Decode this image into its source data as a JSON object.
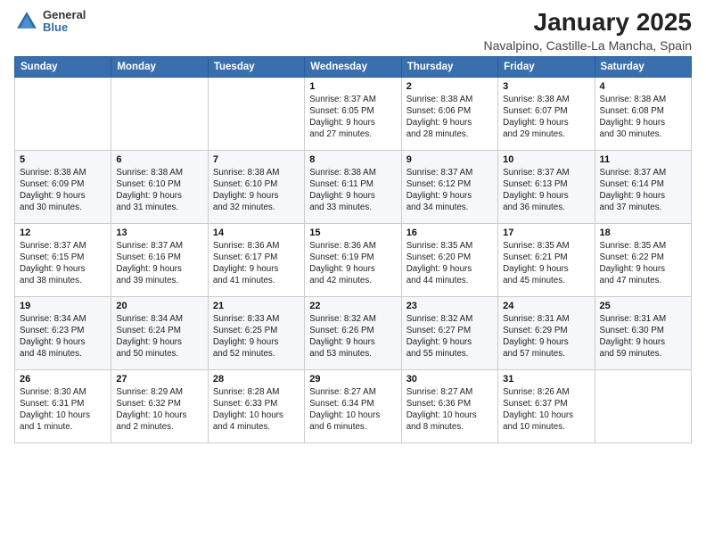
{
  "logo": {
    "general": "General",
    "blue": "Blue"
  },
  "header": {
    "title": "January 2025",
    "subtitle": "Navalpino, Castille-La Mancha, Spain"
  },
  "weekdays": [
    "Sunday",
    "Monday",
    "Tuesday",
    "Wednesday",
    "Thursday",
    "Friday",
    "Saturday"
  ],
  "weeks": [
    [
      {
        "day": "",
        "info": ""
      },
      {
        "day": "",
        "info": ""
      },
      {
        "day": "",
        "info": ""
      },
      {
        "day": "1",
        "info": "Sunrise: 8:37 AM\nSunset: 6:05 PM\nDaylight: 9 hours\nand 27 minutes."
      },
      {
        "day": "2",
        "info": "Sunrise: 8:38 AM\nSunset: 6:06 PM\nDaylight: 9 hours\nand 28 minutes."
      },
      {
        "day": "3",
        "info": "Sunrise: 8:38 AM\nSunset: 6:07 PM\nDaylight: 9 hours\nand 29 minutes."
      },
      {
        "day": "4",
        "info": "Sunrise: 8:38 AM\nSunset: 6:08 PM\nDaylight: 9 hours\nand 30 minutes."
      }
    ],
    [
      {
        "day": "5",
        "info": "Sunrise: 8:38 AM\nSunset: 6:09 PM\nDaylight: 9 hours\nand 30 minutes."
      },
      {
        "day": "6",
        "info": "Sunrise: 8:38 AM\nSunset: 6:10 PM\nDaylight: 9 hours\nand 31 minutes."
      },
      {
        "day": "7",
        "info": "Sunrise: 8:38 AM\nSunset: 6:10 PM\nDaylight: 9 hours\nand 32 minutes."
      },
      {
        "day": "8",
        "info": "Sunrise: 8:38 AM\nSunset: 6:11 PM\nDaylight: 9 hours\nand 33 minutes."
      },
      {
        "day": "9",
        "info": "Sunrise: 8:37 AM\nSunset: 6:12 PM\nDaylight: 9 hours\nand 34 minutes."
      },
      {
        "day": "10",
        "info": "Sunrise: 8:37 AM\nSunset: 6:13 PM\nDaylight: 9 hours\nand 36 minutes."
      },
      {
        "day": "11",
        "info": "Sunrise: 8:37 AM\nSunset: 6:14 PM\nDaylight: 9 hours\nand 37 minutes."
      }
    ],
    [
      {
        "day": "12",
        "info": "Sunrise: 8:37 AM\nSunset: 6:15 PM\nDaylight: 9 hours\nand 38 minutes."
      },
      {
        "day": "13",
        "info": "Sunrise: 8:37 AM\nSunset: 6:16 PM\nDaylight: 9 hours\nand 39 minutes."
      },
      {
        "day": "14",
        "info": "Sunrise: 8:36 AM\nSunset: 6:17 PM\nDaylight: 9 hours\nand 41 minutes."
      },
      {
        "day": "15",
        "info": "Sunrise: 8:36 AM\nSunset: 6:19 PM\nDaylight: 9 hours\nand 42 minutes."
      },
      {
        "day": "16",
        "info": "Sunrise: 8:35 AM\nSunset: 6:20 PM\nDaylight: 9 hours\nand 44 minutes."
      },
      {
        "day": "17",
        "info": "Sunrise: 8:35 AM\nSunset: 6:21 PM\nDaylight: 9 hours\nand 45 minutes."
      },
      {
        "day": "18",
        "info": "Sunrise: 8:35 AM\nSunset: 6:22 PM\nDaylight: 9 hours\nand 47 minutes."
      }
    ],
    [
      {
        "day": "19",
        "info": "Sunrise: 8:34 AM\nSunset: 6:23 PM\nDaylight: 9 hours\nand 48 minutes."
      },
      {
        "day": "20",
        "info": "Sunrise: 8:34 AM\nSunset: 6:24 PM\nDaylight: 9 hours\nand 50 minutes."
      },
      {
        "day": "21",
        "info": "Sunrise: 8:33 AM\nSunset: 6:25 PM\nDaylight: 9 hours\nand 52 minutes."
      },
      {
        "day": "22",
        "info": "Sunrise: 8:32 AM\nSunset: 6:26 PM\nDaylight: 9 hours\nand 53 minutes."
      },
      {
        "day": "23",
        "info": "Sunrise: 8:32 AM\nSunset: 6:27 PM\nDaylight: 9 hours\nand 55 minutes."
      },
      {
        "day": "24",
        "info": "Sunrise: 8:31 AM\nSunset: 6:29 PM\nDaylight: 9 hours\nand 57 minutes."
      },
      {
        "day": "25",
        "info": "Sunrise: 8:31 AM\nSunset: 6:30 PM\nDaylight: 9 hours\nand 59 minutes."
      }
    ],
    [
      {
        "day": "26",
        "info": "Sunrise: 8:30 AM\nSunset: 6:31 PM\nDaylight: 10 hours\nand 1 minute."
      },
      {
        "day": "27",
        "info": "Sunrise: 8:29 AM\nSunset: 6:32 PM\nDaylight: 10 hours\nand 2 minutes."
      },
      {
        "day": "28",
        "info": "Sunrise: 8:28 AM\nSunset: 6:33 PM\nDaylight: 10 hours\nand 4 minutes."
      },
      {
        "day": "29",
        "info": "Sunrise: 8:27 AM\nSunset: 6:34 PM\nDaylight: 10 hours\nand 6 minutes."
      },
      {
        "day": "30",
        "info": "Sunrise: 8:27 AM\nSunset: 6:36 PM\nDaylight: 10 hours\nand 8 minutes."
      },
      {
        "day": "31",
        "info": "Sunrise: 8:26 AM\nSunset: 6:37 PM\nDaylight: 10 hours\nand 10 minutes."
      },
      {
        "day": "",
        "info": ""
      }
    ]
  ]
}
